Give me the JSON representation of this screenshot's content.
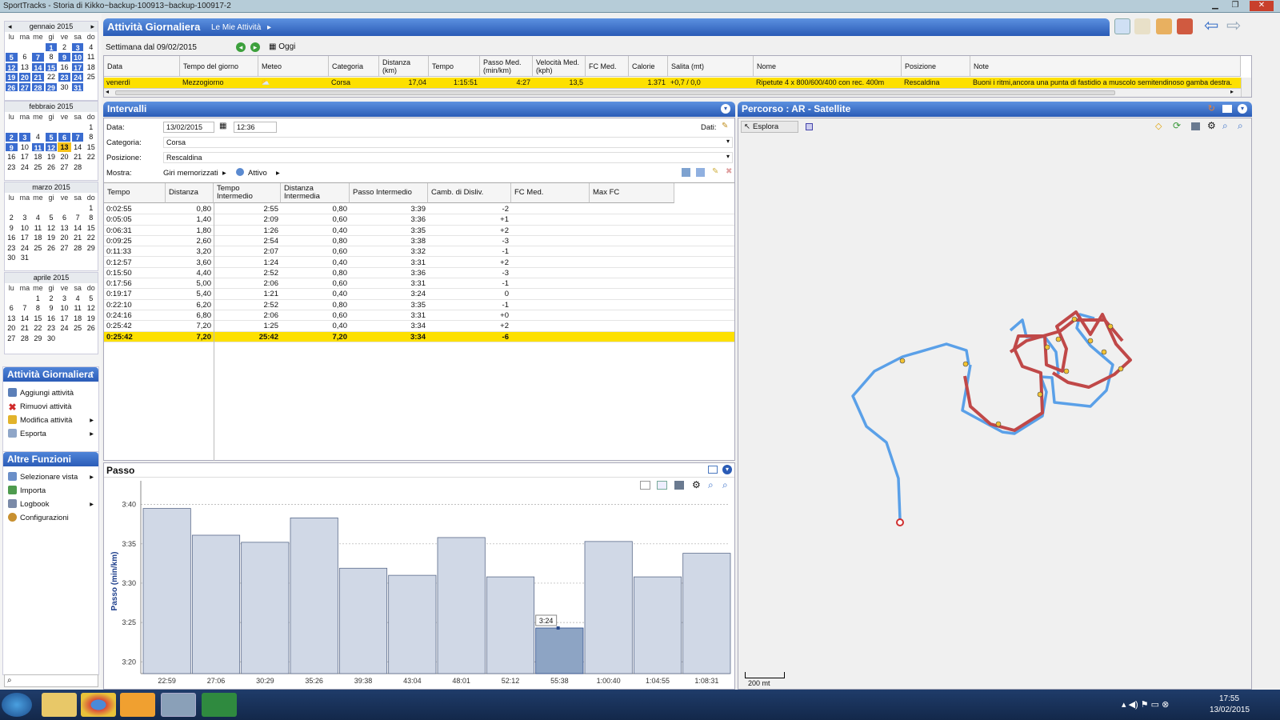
{
  "window": {
    "title": "SportTracks - Storia di Kikko~backup-100913~backup-100917-2"
  },
  "calendar": [
    {
      "title": "gennaio 2015",
      "days": [
        "",
        "",
        "",
        "1",
        "2",
        "3",
        "4",
        "5",
        "6",
        "7",
        "8",
        "9",
        "10",
        "11",
        "12",
        "13",
        "14",
        "15",
        "16",
        "17",
        "18",
        "19",
        "20",
        "21",
        "22",
        "23",
        "24",
        "25",
        "26",
        "27",
        "28",
        "29",
        "30",
        "31"
      ],
      "selected": [
        "1",
        "3",
        "5",
        "7",
        "9",
        "10",
        "12",
        "14",
        "15",
        "17",
        "19",
        "20",
        "21",
        "23",
        "24",
        "26",
        "27",
        "28",
        "29",
        "31"
      ]
    },
    {
      "title": "febbraio 2015",
      "days": [
        "",
        "",
        "",
        "",
        "",
        "",
        "1",
        "2",
        "3",
        "4",
        "5",
        "6",
        "7",
        "8",
        "9",
        "10",
        "11",
        "12",
        "13",
        "14",
        "15",
        "16",
        "17",
        "18",
        "19",
        "20",
        "21",
        "22",
        "23",
        "24",
        "25",
        "26",
        "27",
        "28"
      ],
      "selected": [
        "2",
        "3",
        "5",
        "6",
        "7",
        "9",
        "11",
        "12"
      ],
      "today": "13"
    },
    {
      "title": "marzo 2015",
      "days": [
        "",
        "",
        "",
        "",
        "",
        "",
        "1",
        "2",
        "3",
        "4",
        "5",
        "6",
        "7",
        "8",
        "9",
        "10",
        "11",
        "12",
        "13",
        "14",
        "15",
        "16",
        "17",
        "18",
        "19",
        "20",
        "21",
        "22",
        "23",
        "24",
        "25",
        "26",
        "27",
        "28",
        "29",
        "30",
        "31"
      ],
      "selected": []
    },
    {
      "title": "aprile 2015",
      "days": [
        "",
        "",
        "1",
        "2",
        "3",
        "4",
        "5",
        "6",
        "7",
        "8",
        "9",
        "10",
        "11",
        "12",
        "13",
        "14",
        "15",
        "16",
        "17",
        "18",
        "19",
        "20",
        "21",
        "22",
        "23",
        "24",
        "25",
        "26",
        "27",
        "28",
        "29",
        "30"
      ],
      "selected": []
    }
  ],
  "weekdays": [
    "lu",
    "ma",
    "me",
    "gi",
    "ve",
    "sa",
    "do"
  ],
  "leftPanels": {
    "attivita": {
      "title": "Attività Giornaliera",
      "items": [
        "Aggiungi attività",
        "Rimuovi attività",
        "Modifica attività",
        "Esporta"
      ]
    },
    "altre": {
      "title": "Altre Funzioni",
      "items": [
        "Selezionare vista",
        "Importa",
        "Logbook",
        "Configurazioni"
      ]
    }
  },
  "header": {
    "title": "Attività Giornaliera",
    "breadcrumb": "Le Mie Attività",
    "week": "Settimana dal 09/02/2015",
    "today": "Oggi"
  },
  "activityTable": {
    "columns": [
      "Data",
      "Tempo del giorno",
      "Meteo",
      "Categoria",
      "Distanza (km)",
      "Tempo",
      "Passo Med. (min/km)",
      "Velocità Med. (kph)",
      "FC Med.",
      "Calorie",
      "Salita (mt)",
      "Nome",
      "Posizione",
      "Note"
    ],
    "row": [
      "venerdì",
      "Mezzogiorno",
      "",
      "Corsa",
      "17,04",
      "1:15:51",
      "4:27",
      "13,5",
      "",
      "1.371",
      "+0,7 / 0,0",
      "Ripetute 4 x 800/600/400 con rec. 400m",
      "Rescaldina",
      "Buoni i ritmi,ancora una punta di fastidio a muscolo semitendinoso gamba destra."
    ]
  },
  "intervals": {
    "title": "Intervalli",
    "labels": {
      "data": "Data:",
      "categoria": "Categoria:",
      "posizione": "Posizione:",
      "mostra": "Mostra:",
      "dati": "Dati:"
    },
    "values": {
      "date": "13/02/2015",
      "time": "12:36",
      "categoria": "Corsa",
      "posizione": "Rescaldina",
      "giri": "Giri memorizzati",
      "attivo": "Attivo"
    },
    "columns": [
      "Tempo",
      "Distanza",
      "Tempo Intermedio",
      "Distanza Intermedia",
      "Passo Intermedio",
      "Camb. di Disliv.",
      "FC Med.",
      "Max FC"
    ],
    "rows": [
      [
        "0:02:55",
        "0,80",
        "2:55",
        "0,80",
        "3:39",
        "-2"
      ],
      [
        "0:05:05",
        "1,40",
        "2:09",
        "0,60",
        "3:36",
        "+1"
      ],
      [
        "0:06:31",
        "1,80",
        "1:26",
        "0,40",
        "3:35",
        "+2"
      ],
      [
        "0:09:25",
        "2,60",
        "2:54",
        "0,80",
        "3:38",
        "-3"
      ],
      [
        "0:11:33",
        "3,20",
        "2:07",
        "0,60",
        "3:32",
        "-1"
      ],
      [
        "0:12:57",
        "3,60",
        "1:24",
        "0,40",
        "3:31",
        "+2"
      ],
      [
        "0:15:50",
        "4,40",
        "2:52",
        "0,80",
        "3:36",
        "-3"
      ],
      [
        "0:17:56",
        "5,00",
        "2:06",
        "0,60",
        "3:31",
        "-1"
      ],
      [
        "0:19:17",
        "5,40",
        "1:21",
        "0,40",
        "3:24",
        "0"
      ],
      [
        "0:22:10",
        "6,20",
        "2:52",
        "0,80",
        "3:35",
        "-1"
      ],
      [
        "0:24:16",
        "6,80",
        "2:06",
        "0,60",
        "3:31",
        "+0"
      ],
      [
        "0:25:42",
        "7,20",
        "1:25",
        "0,40",
        "3:34",
        "+2"
      ]
    ],
    "total": [
      "0:25:42",
      "7,20",
      "25:42",
      "7,20",
      "3:34",
      "-6"
    ]
  },
  "map": {
    "title": "Percorso  : AR - Satellite",
    "explore": "Esplora",
    "scale": "200 mt"
  },
  "chart_data": {
    "type": "bar",
    "title": "Passo",
    "ylabel": "Passo (min/km)",
    "categories": [
      "22:59",
      "27:06",
      "30:29",
      "35:26",
      "39:38",
      "43:04",
      "48:01",
      "52:12",
      "55:38",
      "1:00:40",
      "1:04:55",
      "1:08:31"
    ],
    "values": [
      219.5,
      216.1,
      215.2,
      218.3,
      211.9,
      211.0,
      215.8,
      210.8,
      204.3,
      215.3,
      210.8,
      213.8
    ],
    "yticks": [
      "3:20",
      "3:25",
      "3:30",
      "3:35",
      "3:40"
    ],
    "ylim": [
      198.5,
      222
    ],
    "highlight_index": 8,
    "tooltip": "3:24",
    "grid": true
  },
  "taskbar": {
    "time": "17:55",
    "date": "13/02/2015"
  }
}
